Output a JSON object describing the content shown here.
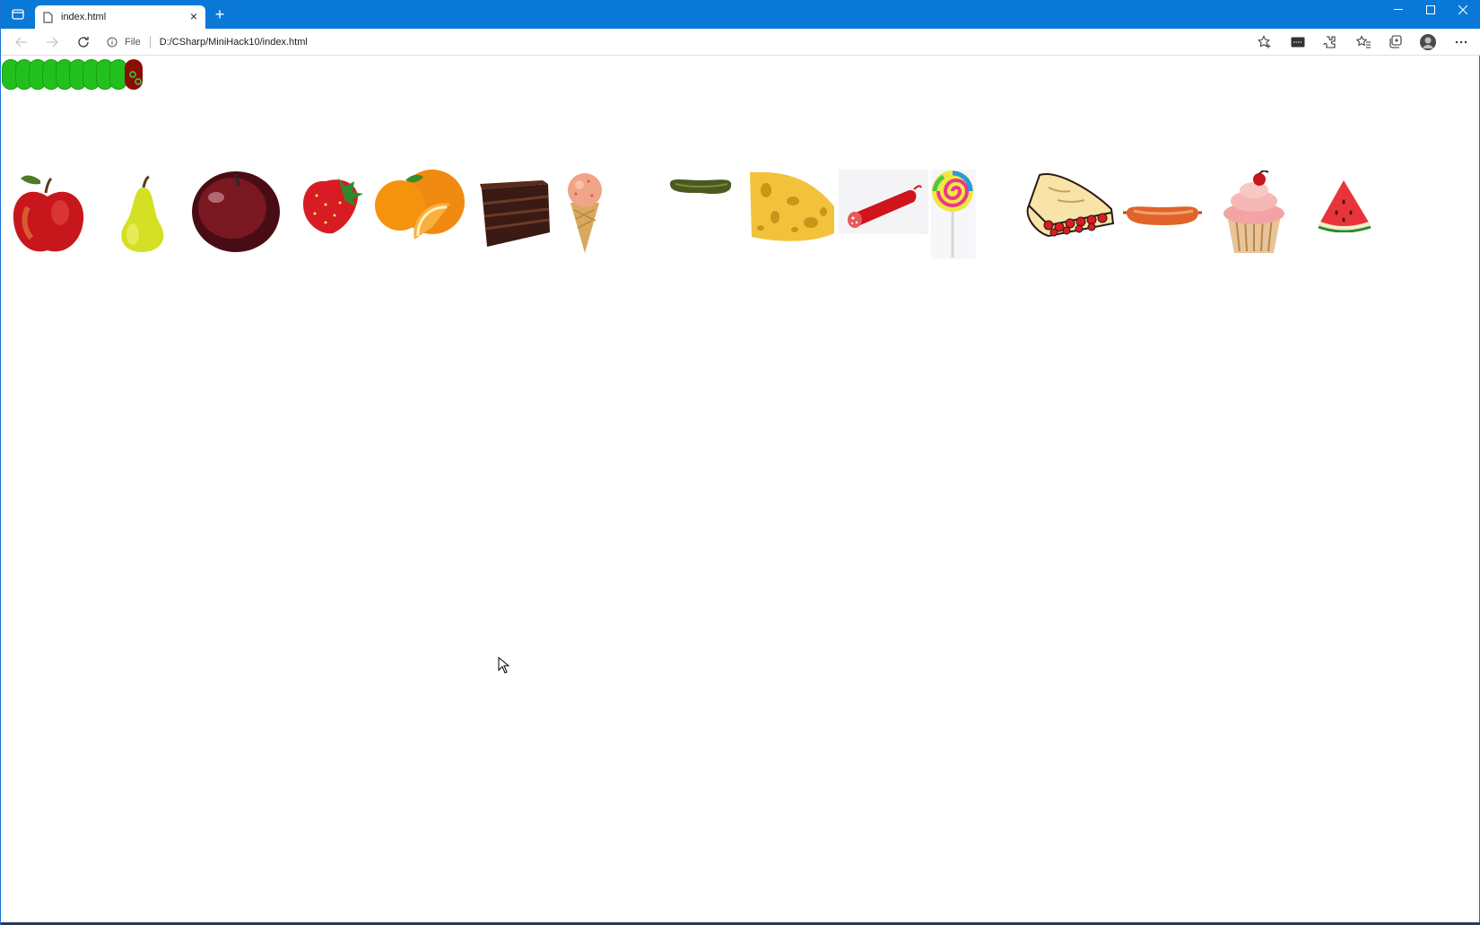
{
  "browser": {
    "tab_title": "index.html",
    "address_scheme_label": "File",
    "address_url": "D:/CSharp/MiniHack10/index.html"
  },
  "colors": {
    "titlebar": "#0a78d7",
    "caterpillar_body": "#22c01c",
    "caterpillar_head": "#8b0d08"
  },
  "game": {
    "caterpillar_segments": 9,
    "foods": [
      "apple",
      "pear",
      "plum",
      "strawberry",
      "orange",
      "chocolate-cake",
      "ice-cream-cone",
      "pickle",
      "swiss-cheese",
      "salami",
      "lollipop",
      "cherry-pie",
      "sausage",
      "cupcake",
      "watermelon"
    ]
  }
}
